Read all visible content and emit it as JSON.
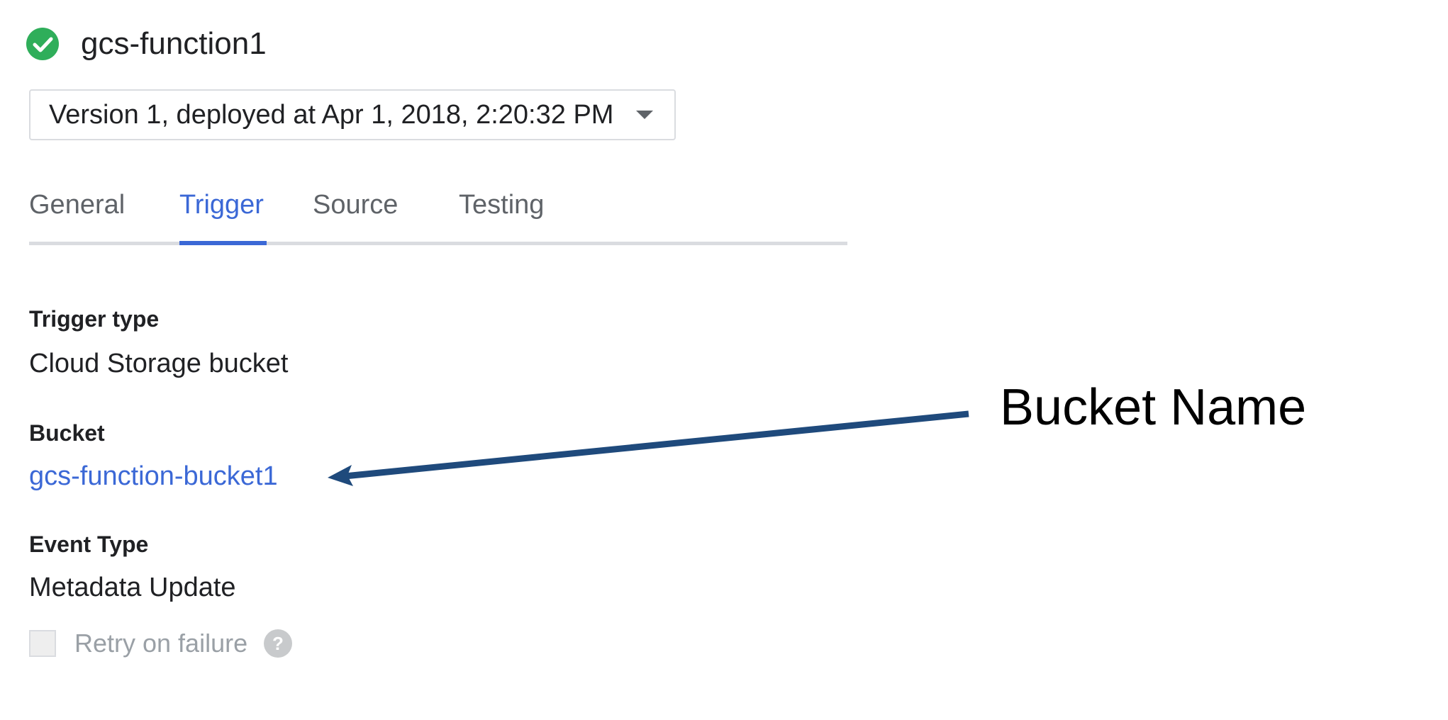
{
  "header": {
    "title": "gcs-function1",
    "status_icon": "check-circle-icon",
    "status_color": "#2fae5a"
  },
  "version_select": {
    "value": "Version 1, deployed at Apr 1, 2018, 2:20:32 PM",
    "icon": "dropdown-arrow-icon"
  },
  "tabs": [
    {
      "label": "General",
      "active": false
    },
    {
      "label": "Trigger",
      "active": true
    },
    {
      "label": "Source",
      "active": false
    },
    {
      "label": "Testing",
      "active": false
    }
  ],
  "details": {
    "trigger_type_label": "Trigger type",
    "trigger_type_value": "Cloud Storage bucket",
    "bucket_label": "Bucket",
    "bucket_value": "gcs-function-bucket1",
    "event_type_label": "Event Type",
    "event_type_value": "Metadata Update"
  },
  "retry": {
    "label": "Retry on failure",
    "checked": false,
    "help_icon": "help-icon"
  },
  "annotation": {
    "label": "Bucket Name",
    "arrow_color": "#1f4a7c"
  },
  "colors": {
    "accent": "#3b68d6",
    "muted": "#9aa0a6"
  }
}
